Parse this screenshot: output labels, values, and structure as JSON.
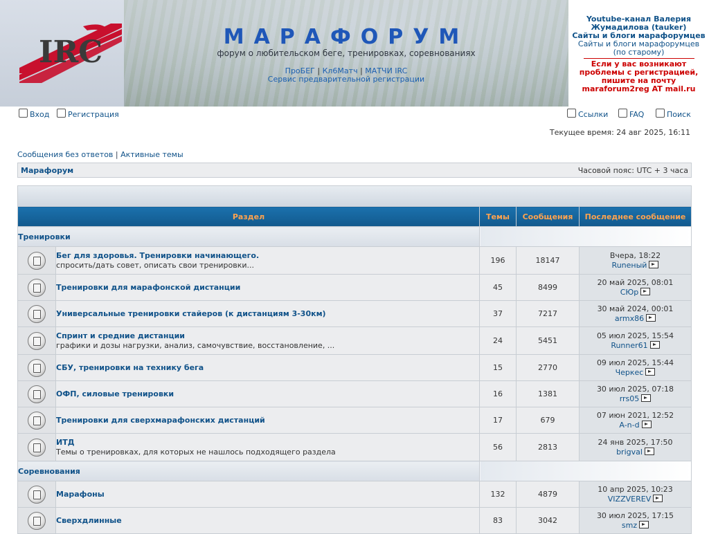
{
  "header": {
    "logo_text": "IRC",
    "site_title": "МАРАФОРУМ",
    "site_description": "форум о любительском беге, тренировках, соревнованиях",
    "links": [
      "ПроБЕГ",
      "Кл6Матч",
      "МАТЧИ IRC"
    ],
    "link_separator": "|",
    "prereg_link": "Сервис предварительной регистрации"
  },
  "side_box": {
    "youtube_line1": "Youtube-канал Валерия",
    "youtube_line2": "Жумадилова (tauker)",
    "blogs_bold": "Сайты и блоги марафорумцев",
    "blogs_old_line1": "Сайты и блоги марафорумцев",
    "blogs_old_line2": "(по старому)",
    "reg_line1": "Если у вас возникают",
    "reg_line2": "проблемы с регистрацией,",
    "reg_line3": "пишите на почту",
    "reg_line4": "maraforum2reg AT mail.ru"
  },
  "navbar": {
    "login": "Вход",
    "register": "Регистрация",
    "links": "Ссылки",
    "faq": "FAQ",
    "search": "Поиск",
    "current_time": "Текущее время: 24 авг 2025, 16:11"
  },
  "quick_links": {
    "unanswered": "Сообщения без ответов",
    "separator": "|",
    "active": "Активные темы"
  },
  "breadcrumb": {
    "home": "Марафорум",
    "timezone": "Часовой пояс: UTC + 3 часа"
  },
  "table": {
    "col_forum": "Раздел",
    "col_topics": "Темы",
    "col_posts": "Сообщения",
    "col_last": "Последнее сообщение",
    "categories": [
      {
        "name": "Тренировки",
        "forums": [
          {
            "title": "Бег для здоровья. Тренировки начинающего.",
            "desc": "спросить/дать совет, описать свои тренировки...",
            "topics": "196",
            "posts": "18147",
            "last_date": "Вчера, 18:22",
            "last_user": "Runeный"
          },
          {
            "title": "Тренировки для марафонской дистанции",
            "desc": "",
            "topics": "45",
            "posts": "8499",
            "last_date": "20 май 2025, 08:01",
            "last_user": "СЮр"
          },
          {
            "title": "Универсальные тренировки стайеров (к дистанциям 3-30км)",
            "desc": "",
            "topics": "37",
            "posts": "7217",
            "last_date": "30 май 2024, 00:01",
            "last_user": "armx86"
          },
          {
            "title": "Спринт и средние дистанции",
            "desc": "графики и дозы нагрузки, анализ, самочувствие, восстановление, ...",
            "topics": "24",
            "posts": "5451",
            "last_date": "05 июл 2025, 15:54",
            "last_user": "Runner61"
          },
          {
            "title": "СБУ, тренировки на технику бега",
            "desc": "",
            "topics": "15",
            "posts": "2770",
            "last_date": "09 июл 2025, 15:44",
            "last_user": "Черкес"
          },
          {
            "title": "ОФП, силовые тренировки",
            "desc": "",
            "topics": "16",
            "posts": "1381",
            "last_date": "30 июл 2025, 07:18",
            "last_user": "rrs05"
          },
          {
            "title": "Тренировки для сверхмарафонских дистанций",
            "desc": "",
            "topics": "17",
            "posts": "679",
            "last_date": "07 июн 2021, 12:52",
            "last_user": "A-n-d"
          },
          {
            "title": "ИТД",
            "desc": "Темы о тренировках, для которых не нашлось подходящего раздела",
            "topics": "56",
            "posts": "2813",
            "last_date": "24 янв 2025, 17:50",
            "last_user": "brigval"
          }
        ]
      },
      {
        "name": "Соревнования",
        "forums": [
          {
            "title": "Марафоны",
            "desc": "",
            "topics": "132",
            "posts": "4879",
            "last_date": "10 апр 2025, 10:23",
            "last_user": "VIZZVEREV"
          },
          {
            "title": "Сверхдлинные",
            "desc": "",
            "topics": "83",
            "posts": "3042",
            "last_date": "30 июл 2025, 17:15",
            "last_user": "smz"
          }
        ]
      }
    ]
  }
}
